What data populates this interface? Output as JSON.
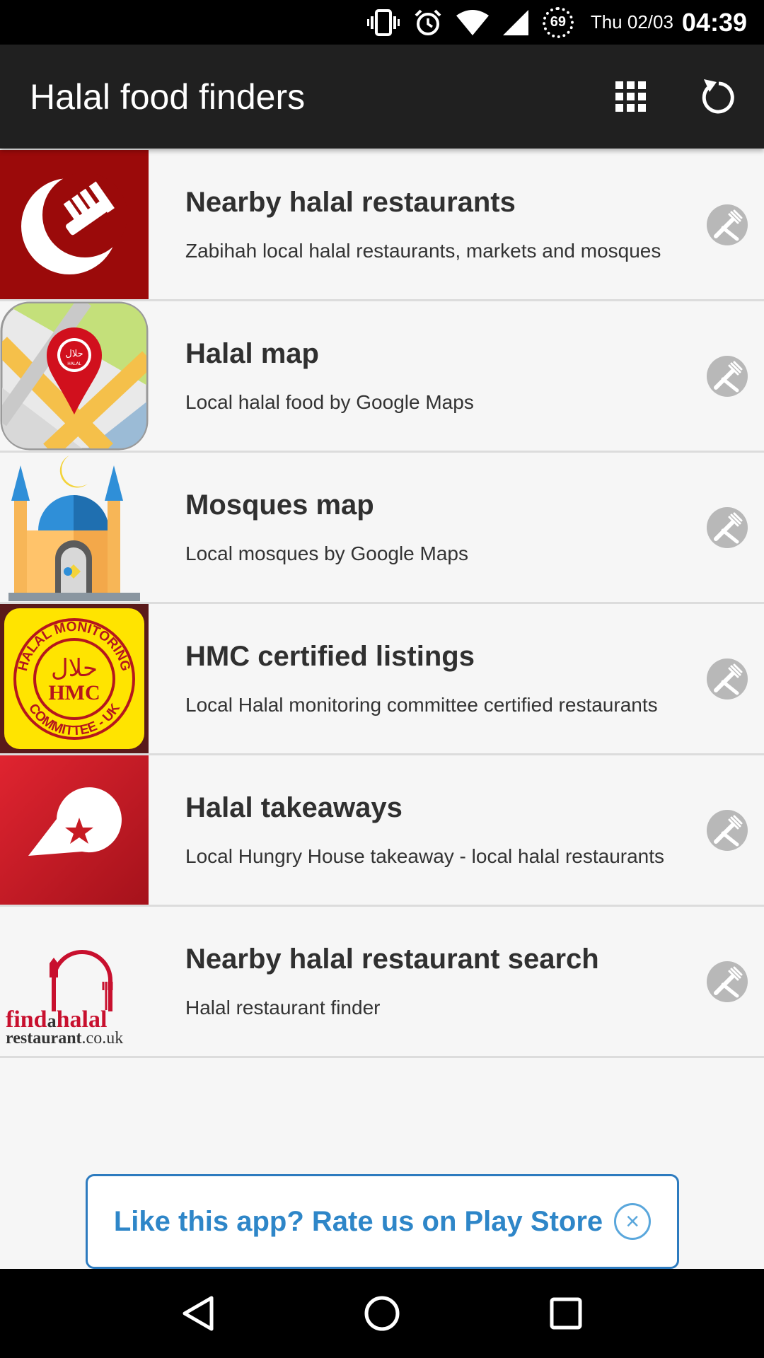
{
  "status_bar": {
    "battery_level": "69",
    "date": "Thu 02/03",
    "time": "04:39"
  },
  "app_bar": {
    "title": "Halal food finders",
    "grid_icon": "grid-icon",
    "refresh_icon": "refresh-icon"
  },
  "list": {
    "items": [
      {
        "title": "Nearby halal restaurants",
        "subtitle": "Zabihah local halal restaurants, markets and mosques",
        "thumb": "zabihah-logo"
      },
      {
        "title": "Halal map",
        "subtitle": "Local halal food by Google Maps",
        "thumb": "halal-map-logo"
      },
      {
        "title": "Mosques map",
        "subtitle": "Local mosques by Google Maps",
        "thumb": "mosque-logo"
      },
      {
        "title": "HMC certified listings",
        "subtitle": "Local Halal monitoring committee certified restaurants",
        "thumb": "hmc-logo"
      },
      {
        "title": "Halal takeaways",
        "subtitle": "Local Hungry House takeaway - local halal restaurants",
        "thumb": "hungry-house-logo"
      },
      {
        "title": "Nearby halal restaurant search",
        "subtitle": "Halal restaurant finder",
        "thumb": "findahalal-logo"
      }
    ],
    "action_icon": "fork-knife-icon"
  },
  "thumbs": {
    "halal_badge": "حلال",
    "halal_word": "HALAL",
    "hmc_top": "HALAL MONITORING",
    "hmc_bottom": "COMMITTEE - UK",
    "hmc_arabic": "حلال",
    "hmc_letters": "HMC",
    "fah_line1a": "find",
    "fah_line1b": "a",
    "fah_line1c": "halal",
    "fah_line2a": "restaurant",
    "fah_line2b": ".co.uk"
  },
  "rate_banner": {
    "text": "Like this app? Rate us on Play Store",
    "close_symbol": "×"
  },
  "nav_bar": {
    "back_icon": "back-icon",
    "home_icon": "home-icon",
    "recents_icon": "recents-icon"
  },
  "colors": {
    "zabihah_red": "#9b0a0a",
    "takeaway_red": "#c71b23",
    "hmc_yellow": "#ffe400",
    "banner_blue": "#2e86c8"
  }
}
